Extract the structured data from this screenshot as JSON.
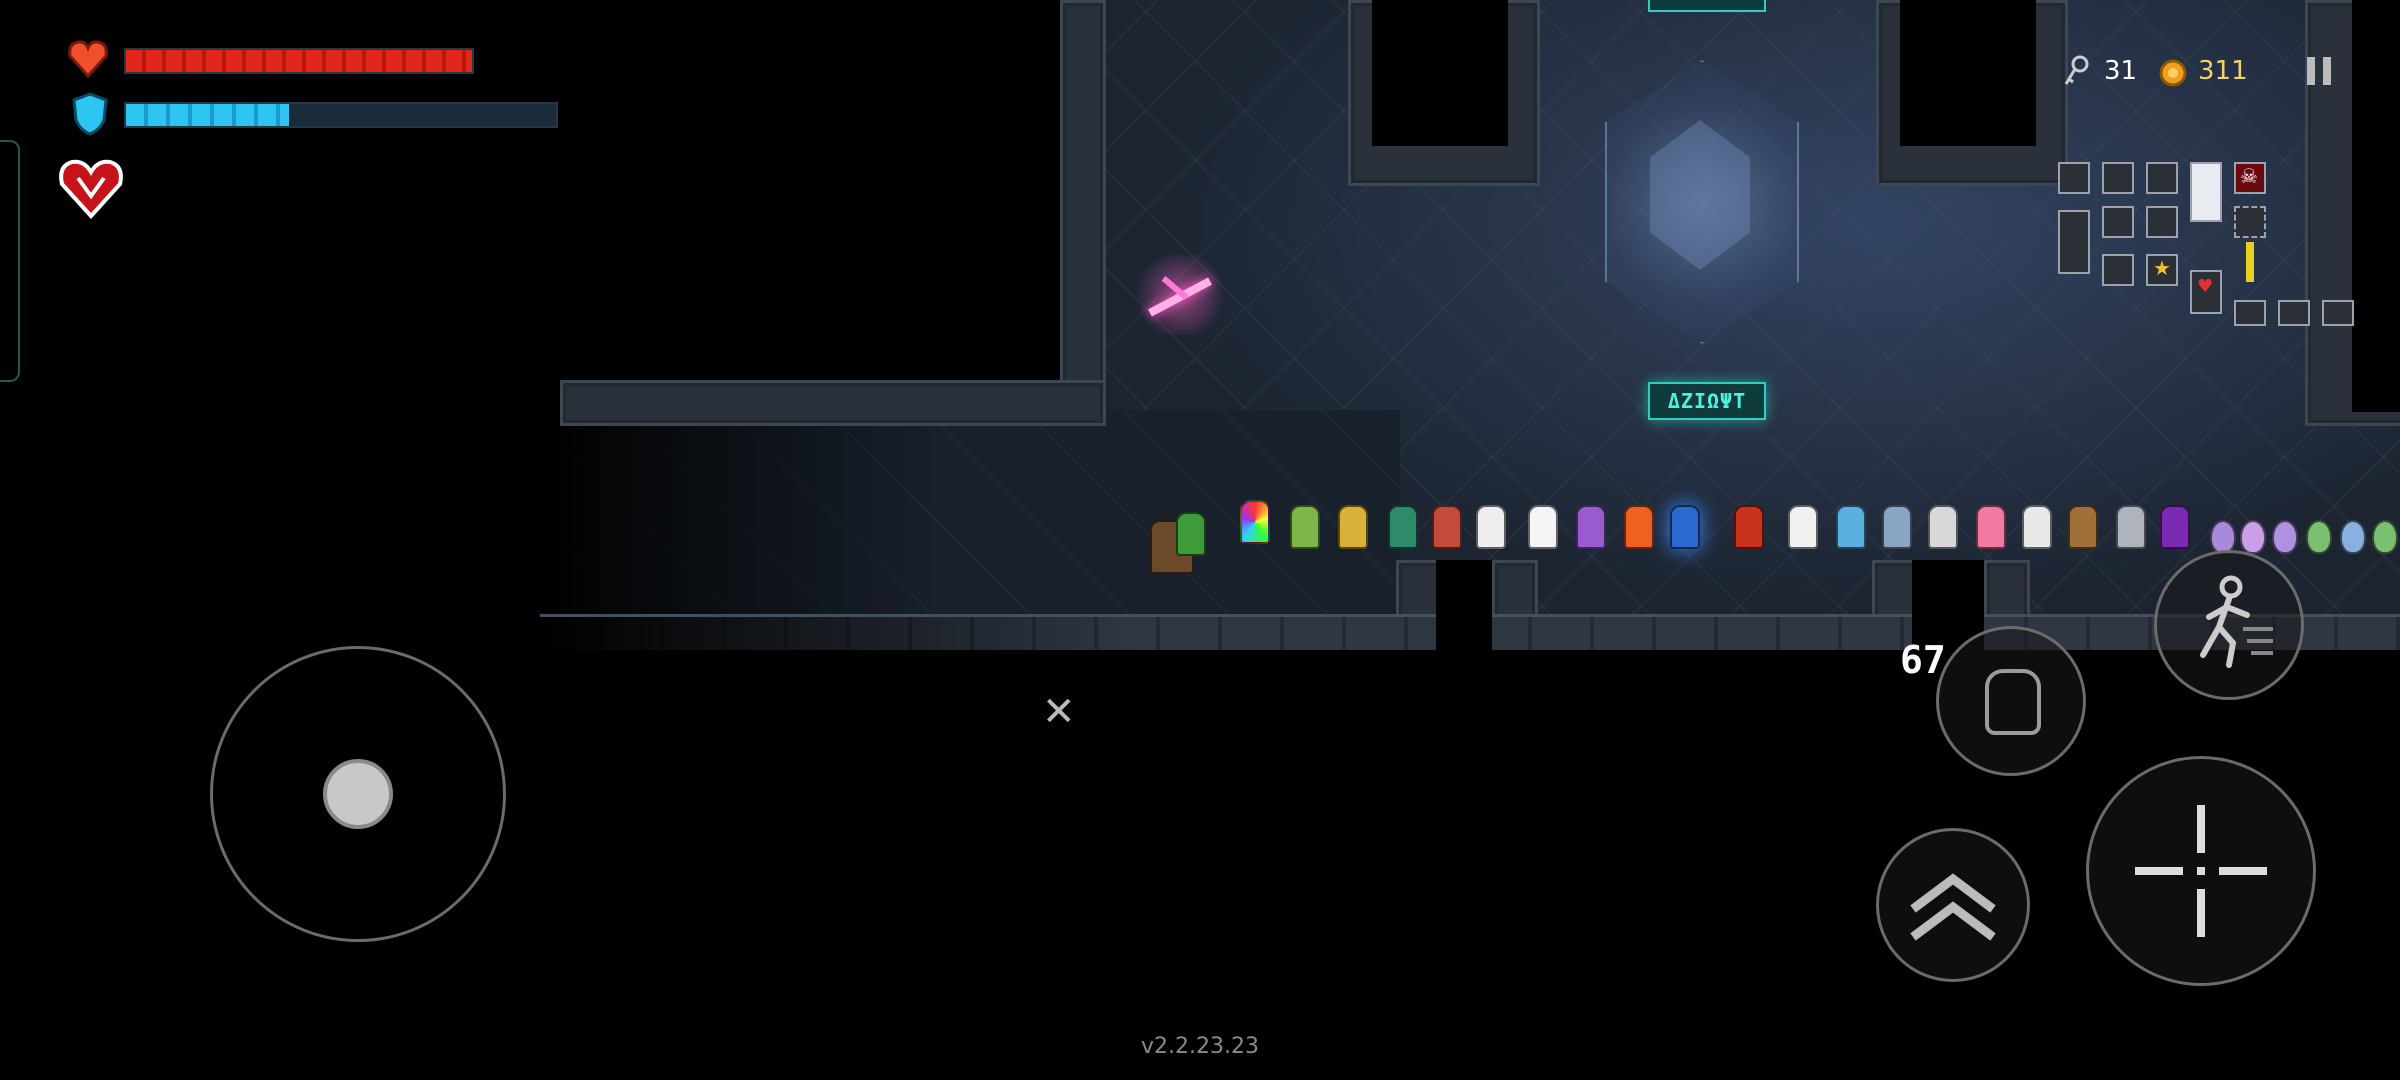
{
  "player": {
    "hp": {
      "current": 14,
      "max": 14,
      "fill": 1.0
    },
    "armor": {
      "current": 4,
      "max": 10,
      "fill": 0.38
    },
    "buff_icon": "demon-heart-icon"
  },
  "resources": {
    "keys": "31",
    "gold": "311",
    "key_icon": "key-icon",
    "gold_icon": "gold-coin-icon"
  },
  "controls": {
    "pause_icon": "pause-icon",
    "joystick_icon": "joystick-icon",
    "skill_icon": "fist-skill-icon",
    "skill_cooldown": "67",
    "dash_icon": "running-figure-icon",
    "swap_icon": "double-chevron-up-icon",
    "attack_icon": "crosshair-icon"
  },
  "scene": {
    "sign_text": "ΔΖΙΩΨΤ",
    "weapon_pickup_icon": "pink-sword-icon",
    "target_marker_icon": "crossed-swords-icon"
  },
  "minimap_icons": {
    "boss_icon": "skull-icon",
    "star_icon": "star-icon",
    "heart_icon": "heart-icon"
  },
  "colors": {
    "hp": "#e2261a",
    "armor": "#2ec5f0",
    "sign": "#2ad0c0",
    "gold": "#f0a020"
  },
  "version": "v2.2.23.23"
}
